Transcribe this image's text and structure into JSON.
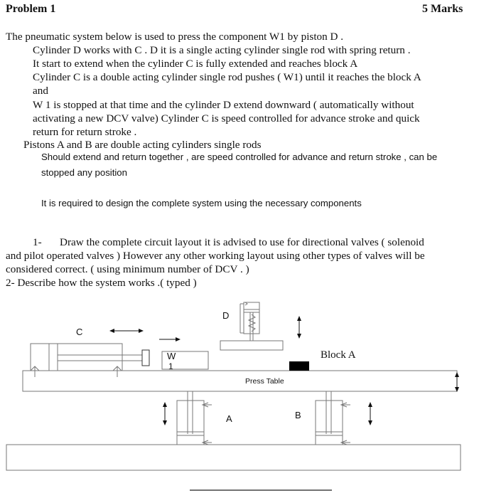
{
  "header": {
    "title": "Problem 1",
    "marks": "5 Marks"
  },
  "intro": {
    "line1": "The pneumatic  system below is used to press the component  W1  by piston D .",
    "lines": [
      "Cylinder D  works with C .  D it is a single acting cylinder single rod with spring return .",
      "It start to extend when the cylinder C is fully extended and reaches block A",
      "Cylinder C  is a double acting  cylinder single rod pushes  ( W1) until it reaches the block A",
      "and",
      "W 1 is stopped at that time and the cylinder D extend downward   ( automatically  without",
      "activating a new DCV valve) Cylinder C is  speed controlled for advance stroke and quick",
      "return for return stroke ."
    ],
    "pistons_line": "Pistons  A  and B  are double acting cylinders single rods",
    "pistons_detail": [
      "Should extend and return together , are speed controlled for advance and return stroke , can be",
      "stopped any position"
    ],
    "requirement": "It is required to design the complete system  using the necessary components"
  },
  "tasks": {
    "task1_number": "1-",
    "task1_lines": [
      "Draw the complete  circuit layout   it is advised to use  for directional valves ( solenoid",
      "and pilot operated valves ) However any other working layout using other types of valves will be",
      "considered correct.  ( using minimum number of DCV . )"
    ],
    "task2": "2-   Describe how the system works .( typed )"
  },
  "diagram": {
    "label_c": "C",
    "label_d": "D",
    "label_w": "W",
    "label_w_sub": "1",
    "label_block": "Block A",
    "label_table": "Press Table",
    "label_a": "A",
    "label_b": "B"
  }
}
